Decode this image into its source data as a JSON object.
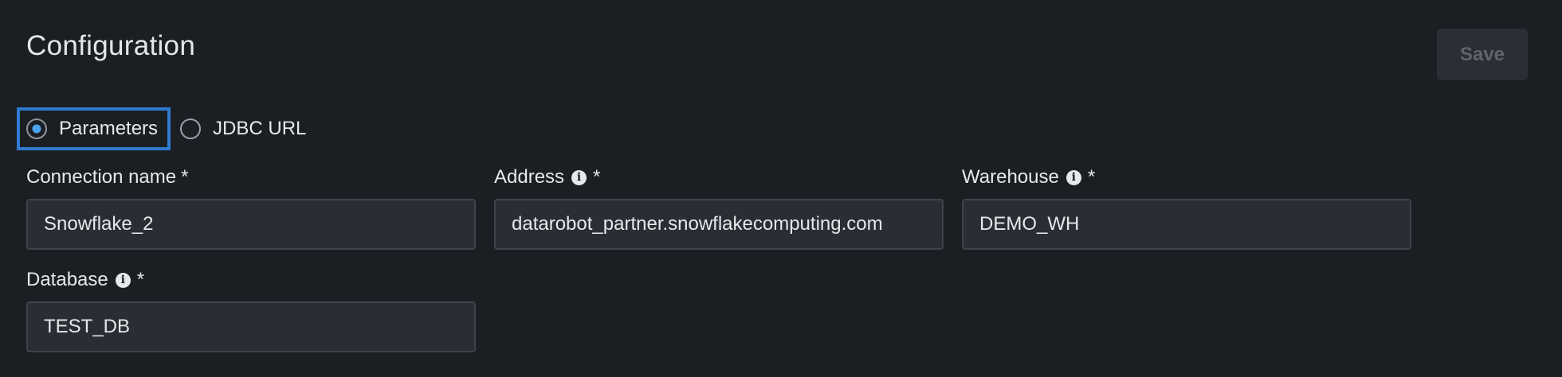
{
  "page": {
    "title": "Configuration",
    "save_label": "Save"
  },
  "connection_mode": {
    "options": [
      {
        "label": "Parameters",
        "selected": true
      },
      {
        "label": "JDBC URL",
        "selected": false
      }
    ]
  },
  "fields": {
    "connection_name": {
      "label": "Connection name",
      "required": "*",
      "value": "Snowflake_2"
    },
    "address": {
      "label": "Address",
      "required": "*",
      "info_icon": "info-icon",
      "value": "datarobot_partner.snowflakecomputing.com"
    },
    "warehouse": {
      "label": "Warehouse",
      "required": "*",
      "info_icon": "info-icon",
      "value": "DEMO_WH"
    },
    "database": {
      "label": "Database",
      "required": "*",
      "info_icon": "info-icon",
      "value": "TEST_DB"
    }
  },
  "colors": {
    "background": "#1b1f24",
    "accent": "#2f7bd0",
    "radio_dot": "#4aa3f0",
    "input_bg": "#2a2e34"
  }
}
